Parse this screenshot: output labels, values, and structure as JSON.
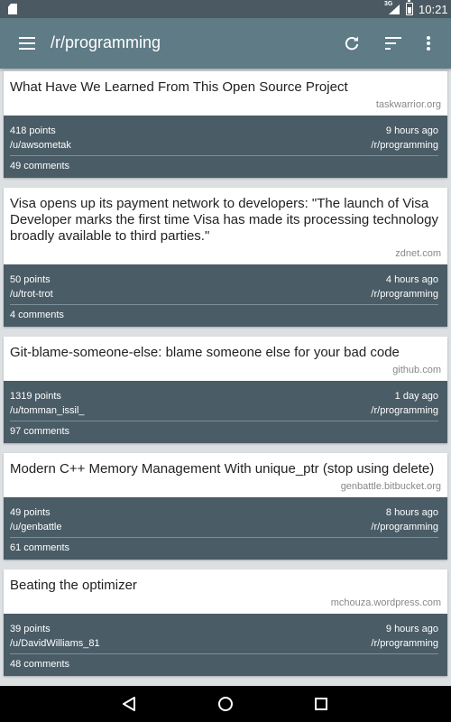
{
  "status": {
    "network": "3G",
    "time": "10:21"
  },
  "appbar": {
    "title": "/r/programming"
  },
  "posts": [
    {
      "title": "What Have We Learned From This Open Source Project",
      "domain": "taskwarrior.org",
      "points": "418 points",
      "time": "9 hours ago",
      "user": "/u/awsometak",
      "sub": "/r/programming",
      "comments": "49 comments"
    },
    {
      "title": "Visa opens up its payment network to developers: \"The launch of Visa Developer marks the first time Visa has made its processing technology broadly available to third parties.\"",
      "domain": "zdnet.com",
      "points": "50 points",
      "time": "4 hours ago",
      "user": "/u/trot-trot",
      "sub": "/r/programming",
      "comments": "4 comments"
    },
    {
      "title": "Git-blame-someone-else: blame someone else for your bad code",
      "domain": "github.com",
      "points": "1319 points",
      "time": "1 day ago",
      "user": "/u/tomman_issil_",
      "sub": "/r/programming",
      "comments": "97 comments"
    },
    {
      "title": "Modern C++ Memory Management With unique_ptr (stop using delete)",
      "domain": "genbattle.bitbucket.org",
      "points": "49 points",
      "time": "8 hours ago",
      "user": "/u/genbattle",
      "sub": "/r/programming",
      "comments": "61 comments"
    },
    {
      "title": "Beating the optimizer",
      "domain": "mchouza.wordpress.com",
      "points": "39 points",
      "time": "9 hours ago",
      "user": "/u/DavidWilliams_81",
      "sub": "/r/programming",
      "comments": "48 comments"
    }
  ],
  "colors": {
    "statusbar": "#4b5a62",
    "appbar": "#5e7b86",
    "card_meta": "#4a5c66",
    "background": "#dde0e2"
  },
  "icons": {
    "menu": "hamburger-icon",
    "refresh": "refresh-icon",
    "sort": "sort-icon",
    "overflow": "more-vert-icon",
    "back": "back-triangle-icon",
    "home": "home-circle-icon",
    "recents": "recents-square-icon"
  }
}
